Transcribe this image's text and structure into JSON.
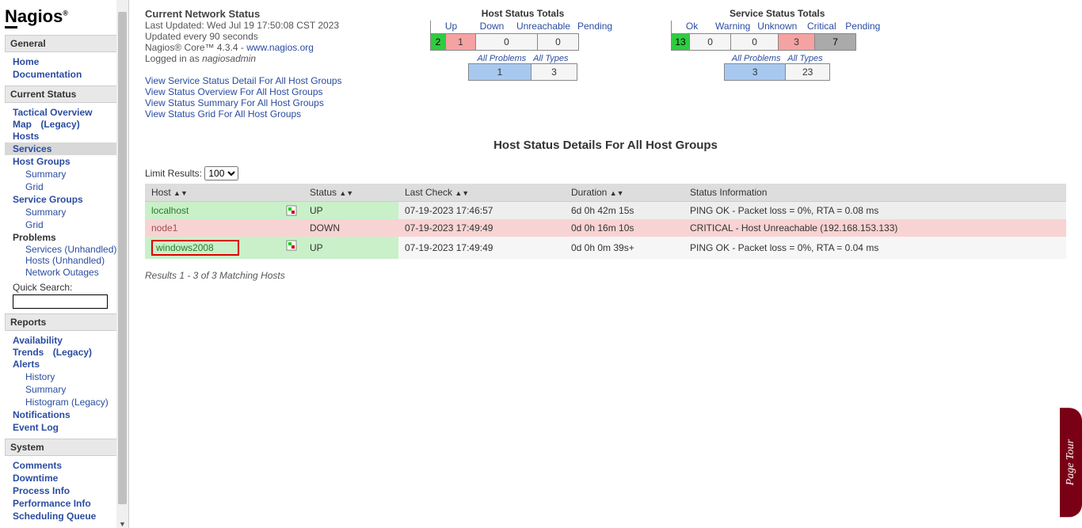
{
  "logo_text": "Nagios",
  "sidebar": {
    "general": {
      "header": "General",
      "home": "Home",
      "docs": "Documentation"
    },
    "current_status": {
      "header": "Current Status",
      "tactical": "Tactical Overview",
      "map": "Map",
      "legacy": "(Legacy)",
      "hosts": "Hosts",
      "services": "Services",
      "hostgroups": "Host Groups",
      "summary": "Summary",
      "grid": "Grid",
      "servicegroups": "Service Groups",
      "problems": "Problems",
      "services_sub": "Services",
      "unhandled": "(Unhandled)",
      "hosts_sub": "Hosts",
      "outages": "Network Outages",
      "quicksearch": "Quick Search:"
    },
    "reports": {
      "header": "Reports",
      "availability": "Availability",
      "trends": "Trends",
      "alerts": "Alerts",
      "history": "History",
      "summary": "Summary",
      "histogram": "Histogram (Legacy)",
      "notifications": "Notifications",
      "eventlog": "Event Log"
    },
    "system": {
      "header": "System",
      "comments": "Comments",
      "downtime": "Downtime",
      "processinfo": "Process Info",
      "perfinfo": "Performance Info",
      "schedqueue": "Scheduling Queue"
    }
  },
  "netstatus": {
    "title": "Current Network Status",
    "updated": "Last Updated: Wed Jul 19 17:50:08 CST 2023",
    "interval": "Updated every 90 seconds",
    "version": "Nagios® Core™ 4.3.4 - ",
    "nagios_url_text": "www.nagios.org",
    "loggedin_prefix": "Logged in as ",
    "loggedin_user": "nagiosadmin",
    "link1": "View Service Status Detail For All Host Groups",
    "link2": "View Status Overview For All Host Groups",
    "link3": "View Status Summary For All Host Groups",
    "link4": "View Status Grid For All Host Groups"
  },
  "host_totals": {
    "title": "Host Status Totals",
    "up_label": "Up",
    "up": "2",
    "down_label": "Down",
    "down": "1",
    "unreach_label": "Unreachable",
    "unreach": "0",
    "pending_label": "Pending",
    "pending": "0",
    "allproblems_label": "All Problems",
    "allproblems": "1",
    "alltypes_label": "All Types",
    "alltypes": "3"
  },
  "service_totals": {
    "title": "Service Status Totals",
    "ok_label": "Ok",
    "ok": "13",
    "warn_label": "Warning",
    "warn": "0",
    "unk_label": "Unknown",
    "unk": "0",
    "crit_label": "Critical",
    "crit": "3",
    "pending_label": "Pending",
    "pending": "7",
    "allproblems_label": "All Problems",
    "allproblems": "3",
    "alltypes_label": "All Types",
    "alltypes": "23"
  },
  "main_heading": "Host Status Details For All Host Groups",
  "limit_label": "Limit Results:",
  "limit_value": "100",
  "table": {
    "col_host": "Host",
    "col_status": "Status",
    "col_lastcheck": "Last Check",
    "col_duration": "Duration",
    "col_info": "Status Information",
    "rows": [
      {
        "host": "localhost",
        "status": "UP",
        "lastcheck": "07-19-2023 17:46:57",
        "duration": "6d 0h 42m 15s",
        "info": "PING OK - Packet loss = 0%, RTA = 0.08 ms"
      },
      {
        "host": "node1",
        "status": "DOWN",
        "lastcheck": "07-19-2023 17:49:49",
        "duration": "0d 0h 16m 10s",
        "info": "CRITICAL - Host Unreachable (192.168.153.133)"
      },
      {
        "host": "windows2008",
        "status": "UP",
        "lastcheck": "07-19-2023 17:49:49",
        "duration": "0d 0h 0m 39s+",
        "info": "PING OK - Packet loss = 0%, RTA = 0.04 ms"
      }
    ]
  },
  "results_count": "Results 1 - 3 of 3 Matching Hosts",
  "pagetour": "Page Tour"
}
